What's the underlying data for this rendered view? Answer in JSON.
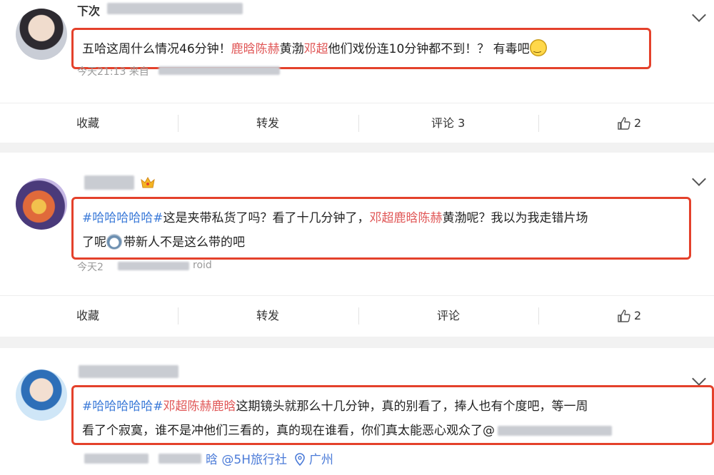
{
  "posts": [
    {
      "username_visible": "下次",
      "time": "今天21:13 来自",
      "text_segments": [
        {
          "t": "五哈这周什么情况46分钟！",
          "c": "normal"
        },
        {
          "t": "鹿晗陈赫",
          "c": "highlight"
        },
        {
          "t": "黄渤",
          "c": "normal"
        },
        {
          "t": "邓超",
          "c": "highlight"
        },
        {
          "t": "他们戏份连10分钟都不到！？ 有毒吧",
          "c": "normal"
        }
      ],
      "actions": {
        "collect": "收藏",
        "forward": "转发",
        "comment": "评论 3",
        "like_count": "2"
      }
    },
    {
      "username_visible": "",
      "time": "今天2",
      "source_suffix": "roid",
      "line1": [
        {
          "t": "#哈哈哈哈哈#",
          "c": "tag"
        },
        {
          "t": "这是夹带私货了吗？看了十几分钟了，",
          "c": "normal"
        },
        {
          "t": "邓超鹿晗陈赫",
          "c": "highlight"
        },
        {
          "t": "黄渤呢？我以为我走错片场",
          "c": "normal"
        }
      ],
      "line2_before": "了呢",
      "line2_after": "带新人不是这么带的吧",
      "actions": {
        "collect": "收藏",
        "forward": "转发",
        "comment": "评论",
        "like_count": "2"
      }
    },
    {
      "username_visible": "",
      "line1": [
        {
          "t": "#哈哈哈哈哈#",
          "c": "tag"
        },
        {
          "t": "邓超陈赫鹿晗",
          "c": "highlight"
        },
        {
          "t": "这期镜头就那么十几分钟，真的别看了，捧人也有个度吧，等一周",
          "c": "normal"
        }
      ],
      "line2": "看了个寂寞，谁不是冲他们三看的，真的现在谁看，你们真太能恶心观众了@",
      "meta_tail": "晗 @5H旅行社",
      "location": "广州"
    }
  ],
  "icons": {
    "chevron": "chevron-down-icon",
    "like": "thumbs-up-icon",
    "crown": "crown-icon",
    "location": "location-pin-icon"
  },
  "colors": {
    "highlight": "#e05656",
    "tag": "#3b7ad8",
    "box": "#e4412b"
  }
}
